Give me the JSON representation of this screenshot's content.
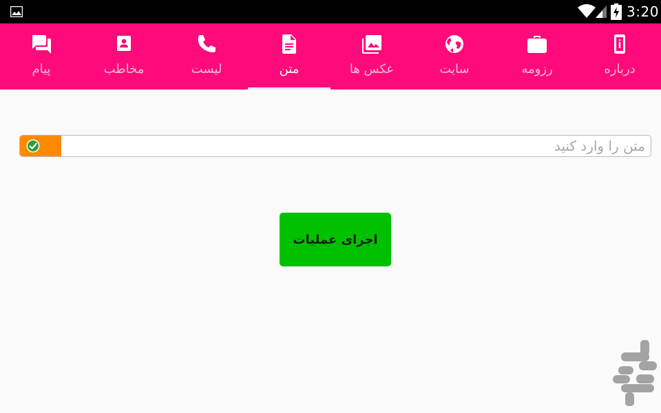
{
  "status_bar": {
    "time": "3:20",
    "icons": [
      "gallery-icon",
      "wifi-icon",
      "signal-icon",
      "battery-charging-icon"
    ]
  },
  "tabs": [
    {
      "label": "درباره",
      "icon": "info-icon",
      "selected": false
    },
    {
      "label": "رزومه",
      "icon": "briefcase-icon",
      "selected": false
    },
    {
      "label": "سایت",
      "icon": "globe-icon",
      "selected": false
    },
    {
      "label": "عکس ها",
      "icon": "photo-library-icon",
      "selected": false
    },
    {
      "label": "متن",
      "icon": "document-icon",
      "selected": true
    },
    {
      "label": "لیست",
      "icon": "phone-icon",
      "selected": false
    },
    {
      "label": "مخاطب",
      "icon": "contact-icon",
      "selected": false
    },
    {
      "label": "پیام",
      "icon": "chat-icon",
      "selected": false
    }
  ],
  "text_field": {
    "placeholder": "متن را وارد کنید",
    "value": "",
    "badge_icon": "check-circle-icon"
  },
  "run_button": {
    "label": "اجرای عملیات"
  },
  "colors": {
    "status_bar": "#000000",
    "tab_bar": "#ff0a7a",
    "tab_indicator": "#e9e3ff",
    "badge": "#ff8a00",
    "run_button": "#00c000",
    "background": "#fafafa"
  }
}
